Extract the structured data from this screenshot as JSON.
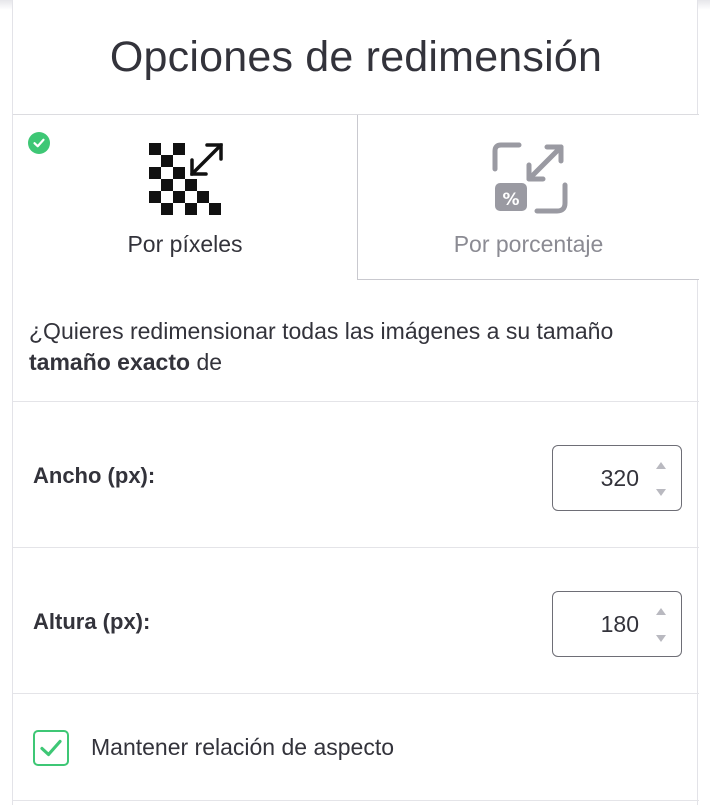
{
  "title": "Opciones de redimensión",
  "tabs": [
    {
      "label": "Por píxeles",
      "icon": "checkerboard-resize-icon",
      "selected": true
    },
    {
      "label": "Por porcentaje",
      "icon": "percent-resize-icon",
      "selected": false
    }
  ],
  "description": {
    "text_before": "¿Quieres redimensionar todas las imágenes a su tamaño ",
    "bold": "tamaño exacto",
    "text_after": " de"
  },
  "width_field": {
    "label": "Ancho (px):",
    "value": "320"
  },
  "height_field": {
    "label": "Altura (px):",
    "value": "180"
  },
  "aspect_checkbox": {
    "label": "Mantener relación de aspecto",
    "checked": true
  },
  "colors": {
    "accent": "#3ec775",
    "text": "#33333b",
    "muted": "#8b8b93"
  }
}
